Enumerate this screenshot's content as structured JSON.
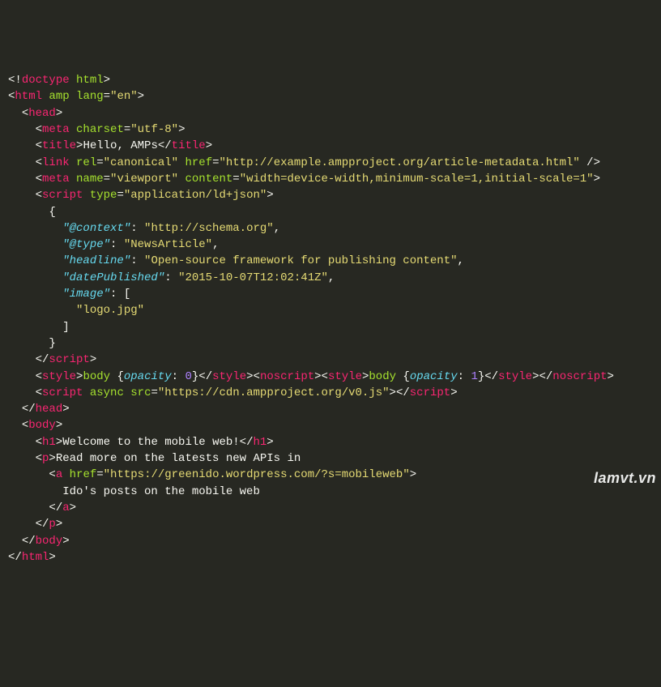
{
  "watermark": "lamvt.vn",
  "code": {
    "doctype": "doctype",
    "html": "html",
    "amp": "amp",
    "lang_attr": "lang",
    "lang_val": "\"en\"",
    "head": "head",
    "meta": "meta",
    "charset_attr": "charset",
    "charset_val": "\"utf-8\"",
    "title": "title",
    "title_text": "Hello, AMPs",
    "link": "link",
    "rel_attr": "rel",
    "rel_val": "\"canonical\"",
    "href_attr": "href",
    "canonical_href": "\"http://example.ampproject.org/article-metadata.html\"",
    "name_attr": "name",
    "viewport_name": "\"viewport\"",
    "content_attr": "content",
    "viewport_content": "\"width=device-width,minimum-scale=1,initial-scale=1\"",
    "script": "script",
    "type_attr": "type",
    "ldjson_type": "\"application/ld+json\"",
    "json_context_key": "\"@context\"",
    "json_context_val": "\"http://schema.org\"",
    "json_type_key": "\"@type\"",
    "json_type_val": "\"NewsArticle\"",
    "json_headline_key": "\"headline\"",
    "json_headline_val": "\"Open-source framework for publishing content\"",
    "json_date_key": "\"datePublished\"",
    "json_date_val": "\"2015-10-07T12:02:41Z\"",
    "json_image_key": "\"image\"",
    "json_image_val": "\"logo.jpg\"",
    "style": "style",
    "noscript": "noscript",
    "body_sel": "body",
    "opacity_prop": "opacity",
    "zero": "0",
    "one": "1",
    "async_attr": "async",
    "src_attr": "src",
    "amp_src": "\"https://cdn.ampproject.org/v0.js\"",
    "body": "body",
    "h1": "h1",
    "h1_text": "Welcome to the mobile web!",
    "p_tag": "p",
    "p_text": "Read more on the latests new APIs in",
    "a_tag": "a",
    "a_href": "\"https://greenido.wordpress.com/?s=mobileweb\"",
    "a_text": "Ido's posts on the mobile web"
  }
}
